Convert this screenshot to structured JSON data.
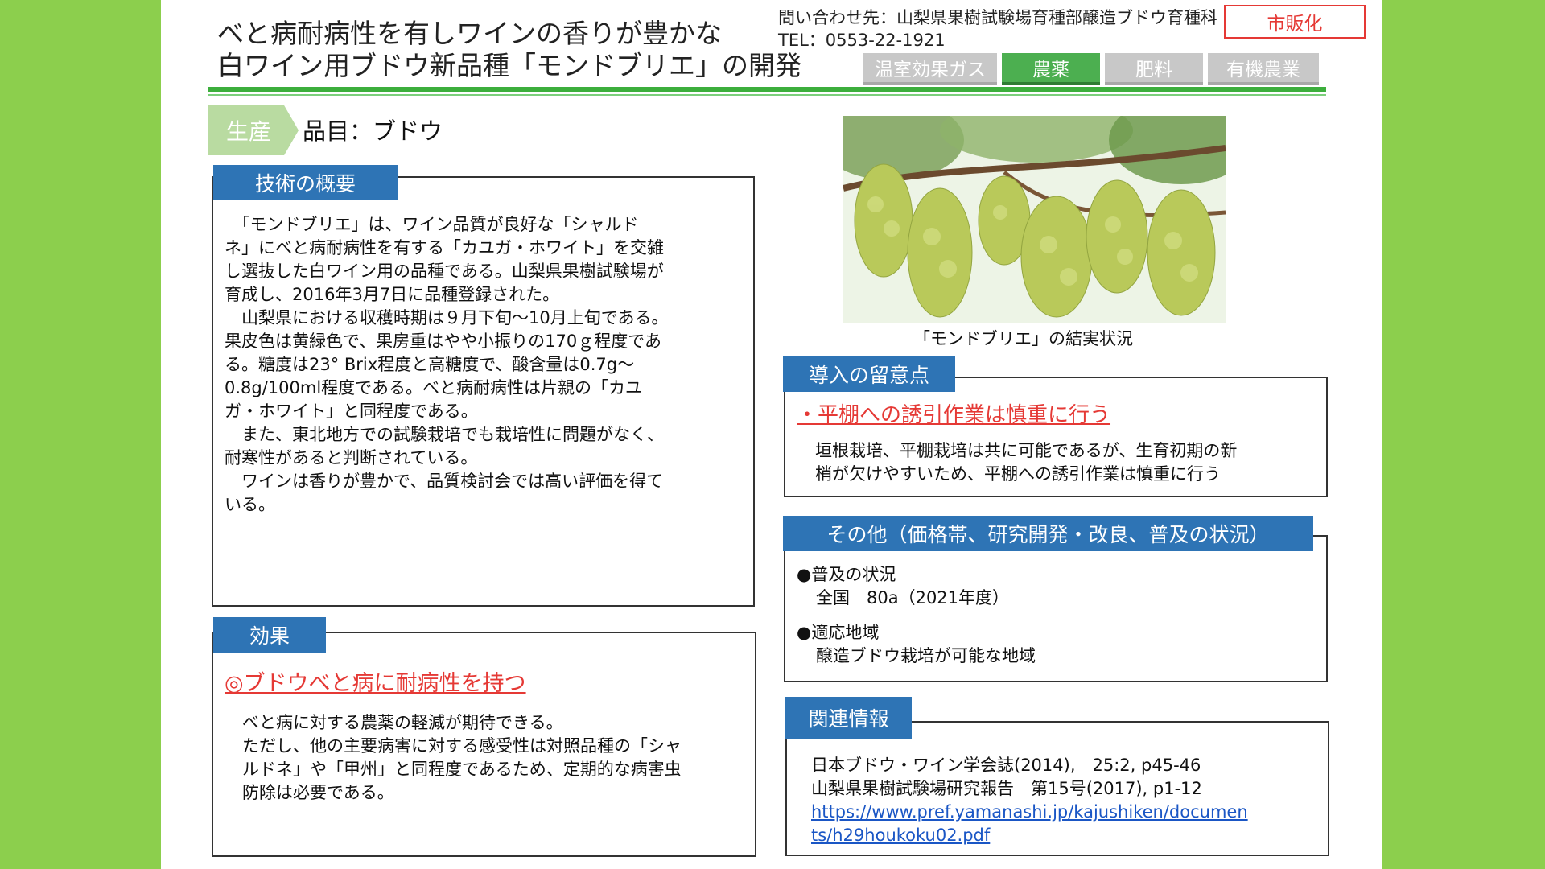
{
  "header": {
    "title_line1": "べと病耐病性を有しワインの香りが豊かな",
    "title_line2": "白ワイン用ブドウ新品種「モンドブリエ」の開発",
    "contact_line1": "問い合わせ先：山梨県果樹試験場育種部醸造ブドウ育種科",
    "contact_line2": "TEL：0553-22-1921",
    "badge": "市販化",
    "tabs": [
      {
        "label": "温室効果ガス",
        "active": false
      },
      {
        "label": "農薬",
        "active": true
      },
      {
        "label": "肥料",
        "active": false
      },
      {
        "label": "有機農業",
        "active": false
      }
    ]
  },
  "category": {
    "chip": "生産",
    "item": "品目：ブドウ"
  },
  "overview": {
    "heading": "技術の概要",
    "lines": [
      "　「モンドブリエ」は、ワイン品質が良好な「シャルド",
      "ネ」にべと病耐病性を有する「カユガ・ホワイト」を交雑",
      "し選抜した白ワイン用の品種である。山梨県果樹試験場が",
      "育成し、2016年3月7日に品種登録された。",
      "　山梨県における収穫時期は９月下旬～10月上旬である。",
      "果皮色は黄緑色で、果房重はやや小振りの170ｇ程度であ",
      "る。糖度は23° Brix程度と高糖度で、酸含量は0.7g～",
      "0.8g/100ml程度である。べと病耐病性は片親の「カユ",
      "ガ・ホワイト」と同程度である。",
      "　また、東北地方での試験栽培でも栽培性に問題がなく、",
      "耐寒性があると判断されている。",
      "　ワインは香りが豊かで、品質検討会では高い評価を得て",
      "いる。"
    ]
  },
  "effect": {
    "heading": "効果",
    "subheading": "◎ブドウべと病に耐病性を持つ",
    "lines": [
      "べと病に対する農薬の軽減が期待できる。",
      "ただし、他の主要病害に対する感受性は対照品種の「シャ",
      "ルドネ」や「甲州」と同程度であるため、定期的な病害虫",
      "防除は必要である。"
    ]
  },
  "photo": {
    "caption": "「モンドブリエ」の結実状況"
  },
  "notes": {
    "heading": "導入の留意点",
    "point": "・平棚への誘引作業は慎重に行う",
    "lines": [
      "垣根栽培、平棚栽培は共に可能であるが、生育初期の新",
      "梢が欠けやすいため、平棚への誘引作業は慎重に行う"
    ]
  },
  "other": {
    "heading": "その他（価格帯、研究開発・改良、普及の状況）",
    "item1_title": "●普及の状況",
    "item1_value": "全国　80a（2021年度）",
    "item2_title": "●適応地域",
    "item2_value": "醸造ブドウ栽培が可能な地域"
  },
  "related": {
    "heading": "関連情報",
    "ref1": "日本ブドウ・ワイン学会誌(2014),　25:2, p45-46",
    "ref2": "山梨県果樹試験場研究報告　第15号(2017), p1-12",
    "url_line1": "https://www.pref.yamanashi.jp/kajushiken/documen",
    "url_line2": "ts/h29houkoku02.pdf"
  },
  "colors": {
    "background_green": "#8ccf4d",
    "accent_blue": "#2e74b5",
    "accent_red": "#e53935",
    "tab_active": "#4caf50",
    "tab_inactive": "#c8c8c8"
  }
}
